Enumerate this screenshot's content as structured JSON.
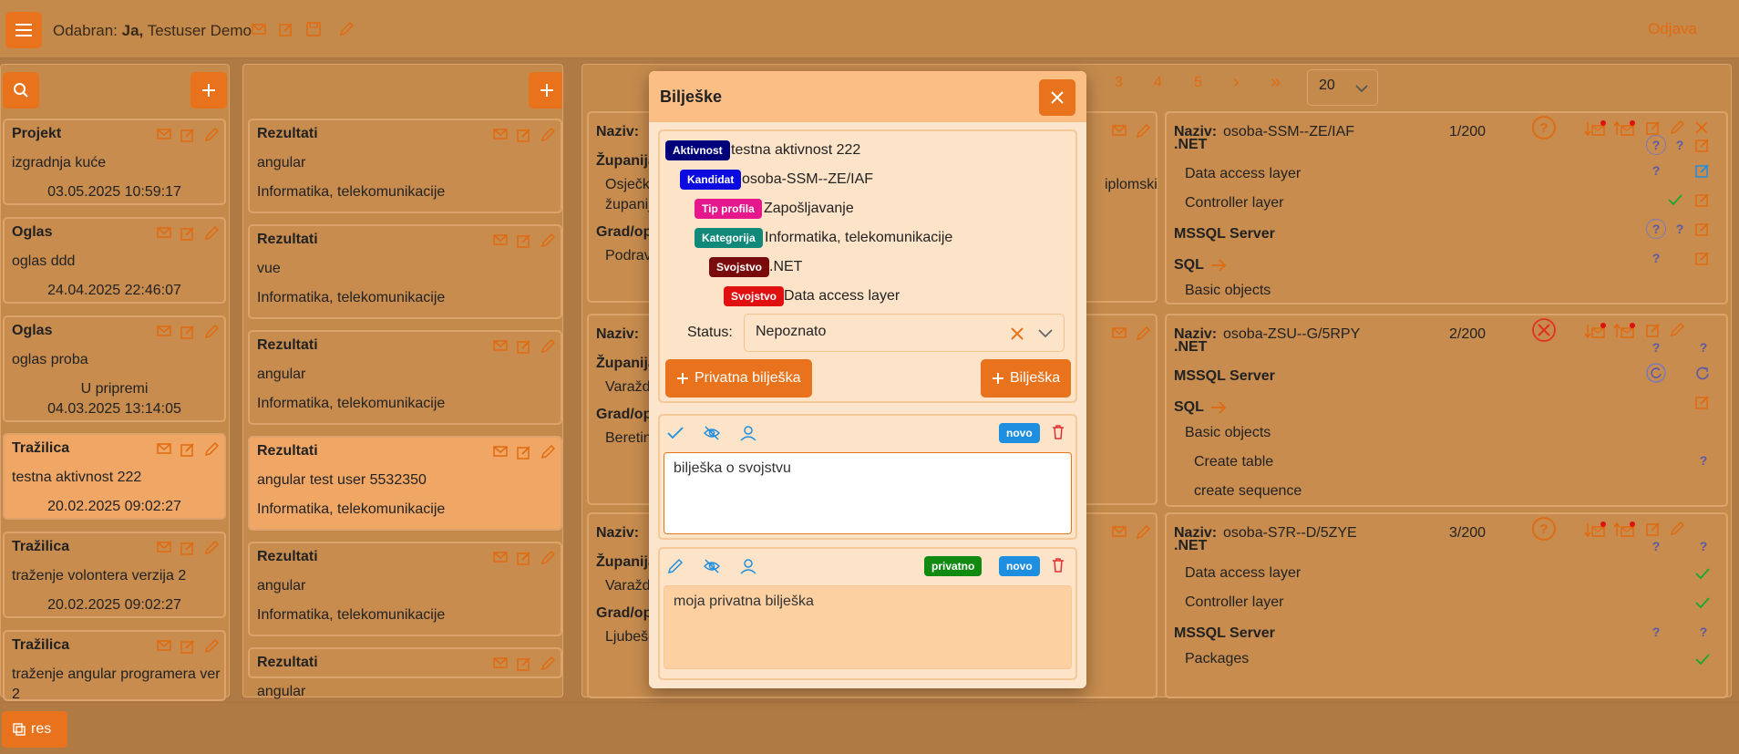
{
  "topbar": {
    "selected_prefix": "Odabran:",
    "selected_who": "Ja,",
    "selected_user": "Testuser Demo",
    "logout": "Odjava"
  },
  "col1": {
    "cards": [
      {
        "title": "Projekt",
        "line1": "izgradnja kuće",
        "line2": "03.05.2025 10:59:17"
      },
      {
        "title": "Oglas",
        "line1": "oglas ddd",
        "line2": "24.04.2025 22:46:07"
      },
      {
        "title": "Oglas",
        "line1": "oglas proba",
        "status": "U pripremi",
        "line2": "04.03.2025 13:14:05"
      },
      {
        "title": "Tražilica",
        "line1": "testna aktivnost 222",
        "line2": "20.02.2025 09:02:27"
      },
      {
        "title": "Tražilica",
        "line1": "traženje volontera verzija 2",
        "line2": "20.02.2025 09:02:27"
      },
      {
        "title": "Tražilica",
        "line1": "traženje angular programera ver",
        "line2": "2"
      }
    ]
  },
  "col2": {
    "cards": [
      {
        "title": "Rezultati",
        "line1": "angular",
        "line2": "Informatika, telekomunikacije"
      },
      {
        "title": "Rezultati",
        "line1": "vue",
        "line2": "Informatika, telekomunikacije"
      },
      {
        "title": "Rezultati",
        "line1": "angular",
        "line2": "Informatika, telekomunikacije"
      },
      {
        "title": "Rezultati",
        "line1": "angular test user 5532350",
        "line2": "Informatika, telekomunikacije"
      },
      {
        "title": "Rezultati",
        "line1": "angular",
        "line2": "Informatika, telekomunikacije"
      },
      {
        "title": "Rezultati",
        "line1": "angular",
        "line2": ""
      }
    ]
  },
  "col3": {
    "cards": [
      {
        "naziv": "Naziv:",
        "naziv_val": "o",
        "zup": "Županija",
        "zup_val": "Osječk",
        "zup_val2": "županij",
        "grad": "Grad/op",
        "grad_val": "Podrav",
        "side": "iplomski"
      },
      {
        "naziv": "Naziv:",
        "naziv_val": "o",
        "zup": "Županija",
        "zup_val": "Varažd",
        "grad": "Grad/op",
        "grad_val": "Beretin"
      },
      {
        "naziv": "Naziv:",
        "naziv_val": "o",
        "zup": "Županija",
        "zup_val": "Varažd",
        "grad": "Grad/op",
        "grad_val": "Ljubešć"
      }
    ]
  },
  "pagination": {
    "pages": [
      "3",
      "4",
      "5"
    ],
    "next": "›",
    "last": "»",
    "page_size": "20"
  },
  "col4": {
    "cards": [
      {
        "naziv": "Naziv:",
        "name": "osoba-SSM--ZE/IAF",
        "count": "1/200",
        "lines": [
          ".NET",
          "Data access layer",
          "Controller layer",
          "MSSQL Server",
          "SQL",
          "Basic objects"
        ]
      },
      {
        "naziv": "Naziv:",
        "name": "osoba-ZSU--G/5RPY",
        "count": "2/200",
        "lines": [
          ".NET",
          "MSSQL Server",
          "SQL",
          "Basic objects",
          "Create table",
          "create sequence"
        ]
      },
      {
        "naziv": "Naziv:",
        "name": "osoba-S7R--D/5ZYE",
        "count": "3/200",
        "lines": [
          ".NET",
          "Data access layer",
          "Controller layer",
          "MSSQL Server",
          "Packages"
        ]
      }
    ]
  },
  "modal": {
    "title": "Bilješke",
    "tags": [
      {
        "tag": "Aktivnost",
        "text": "testna aktivnost 222",
        "color": "#00007a"
      },
      {
        "tag": "Kandidat",
        "text": "osoba-SSM--ZE/IAF",
        "color": "#0b0be0"
      },
      {
        "tag": "Tip profila",
        "text": "Zapošljavanje",
        "color": "#e6168c"
      },
      {
        "tag": "Kategorija",
        "text": "Informatika, telekomunikacije",
        "color": "#10887a"
      },
      {
        "tag": "Svojstvo",
        "text": ".NET",
        "color": "#7a0b0b"
      },
      {
        "tag": "Svojstvo",
        "text": "Data access layer",
        "color": "#e01010"
      }
    ],
    "status_label": "Status:",
    "status_value": "Nepoznato",
    "private_note_btn": "Privatna bilješka",
    "note_btn": "Bilješka",
    "note1": {
      "badge_new": "novo",
      "text": "bilješka o svojstvu"
    },
    "note2": {
      "badge_private": "privatno",
      "badge_new": "novo",
      "text": "moja privatna bilješka"
    }
  },
  "bottom": {
    "res_label": "res"
  },
  "colors": {
    "accent": "#e8731c",
    "bg": "#c48a4c"
  }
}
